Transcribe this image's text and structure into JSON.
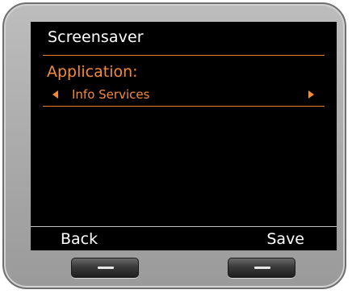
{
  "screen": {
    "title": "Screensaver",
    "setting_label": "Application:",
    "setting_value": "Info Services"
  },
  "softkeys": {
    "left_label": "Back",
    "right_label": "Save"
  },
  "icons": {
    "value_prev": "triangle-left-icon",
    "value_next": "triangle-right-icon"
  },
  "colors": {
    "accent": "#f58a3a",
    "screen_background": "#000000",
    "text": "#ffffff",
    "device_bezel": "#a9a9a9"
  }
}
